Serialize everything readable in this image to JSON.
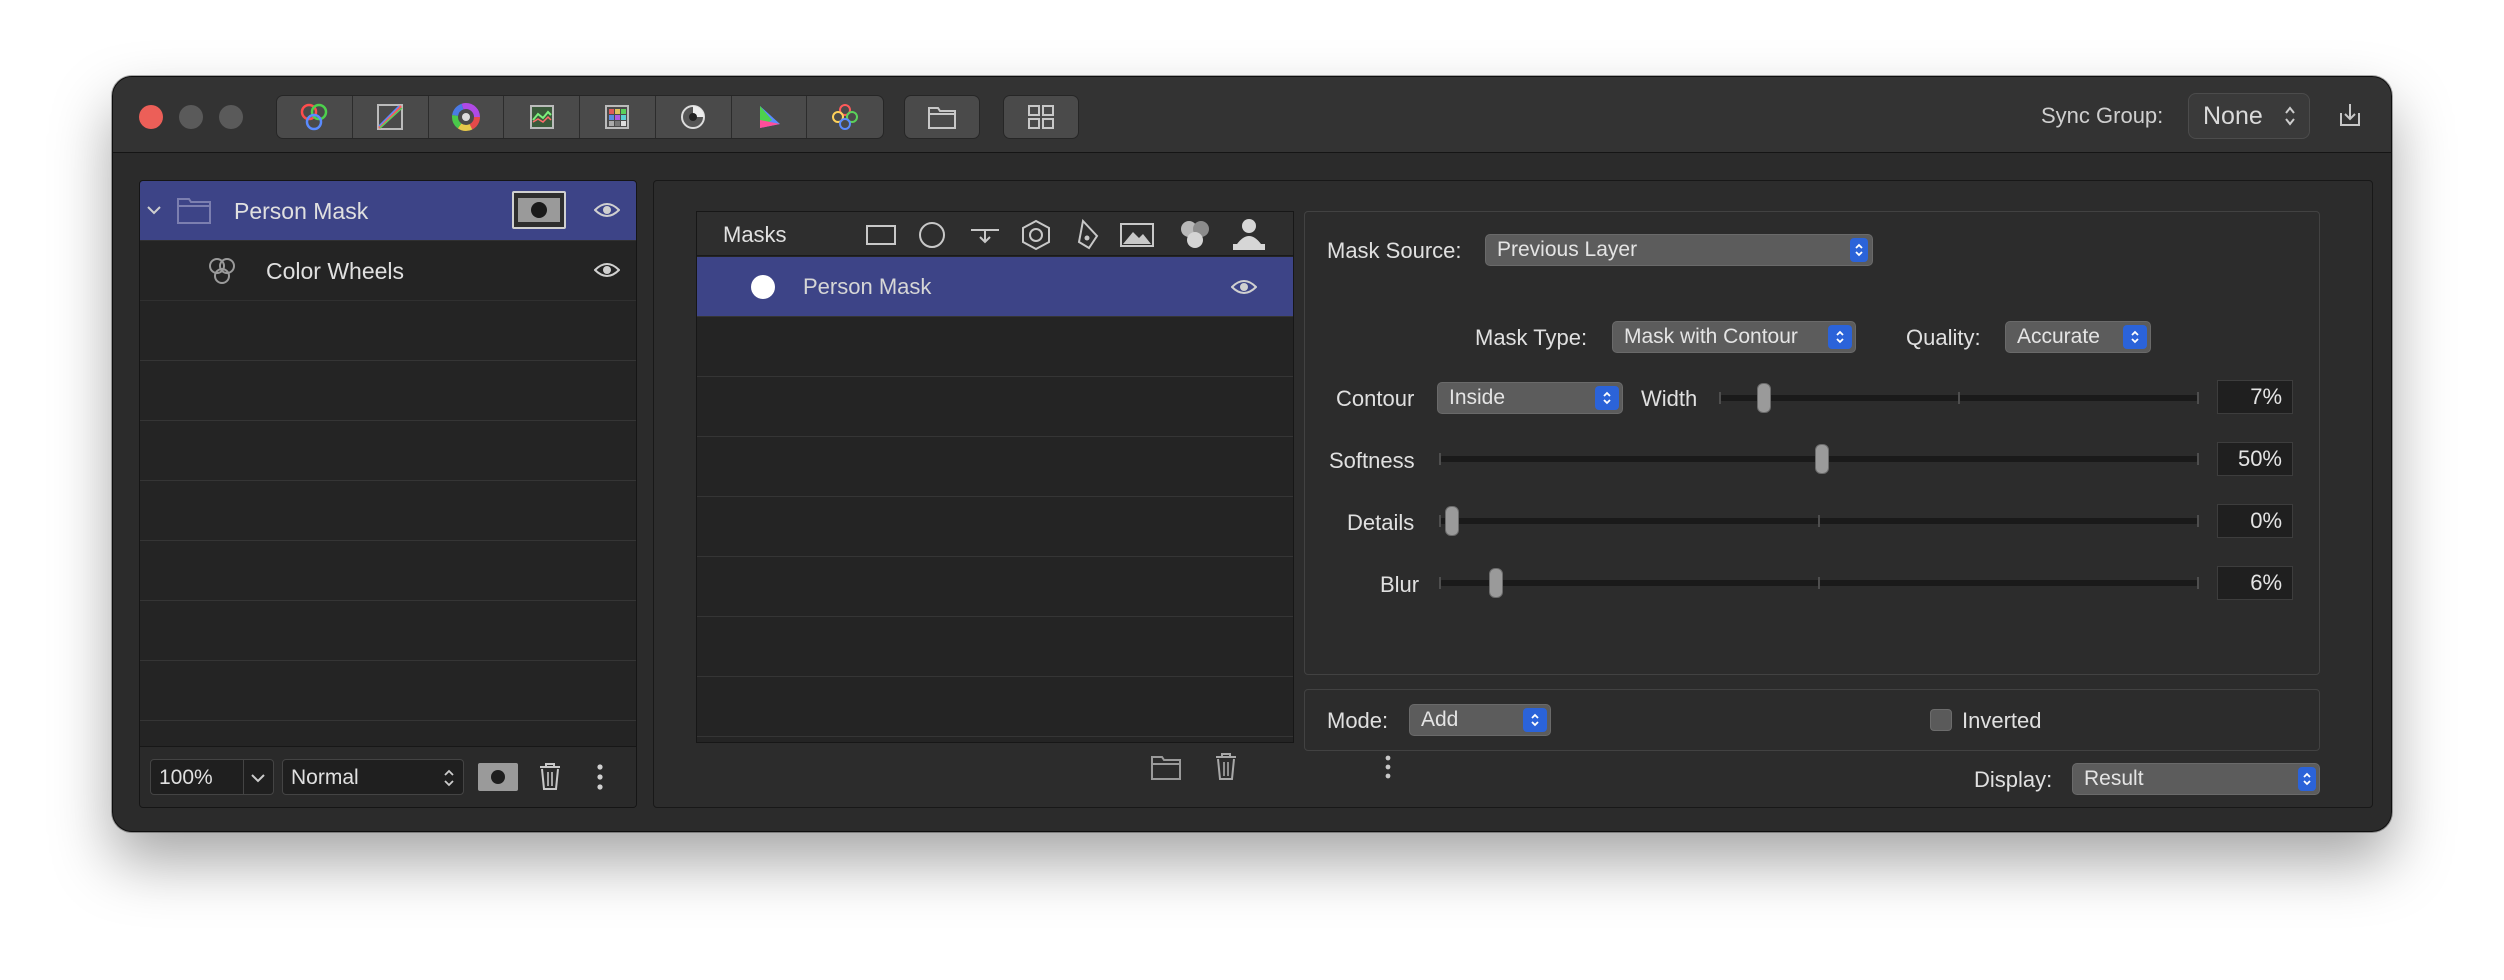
{
  "toolbar": {
    "sync_label": "Sync Group:",
    "sync_value": "None",
    "buttons": [
      "color-wheels-icon",
      "curves-icon",
      "hue-ring-icon",
      "waveform-icon",
      "grid-lut-icon",
      "lens-icon",
      "gamut-triangle-icon",
      "color-channels-icon",
      "folder-icon",
      "grid-view-icon",
      "export-icon"
    ]
  },
  "layers": {
    "items": [
      {
        "label": "Person Mask",
        "selected": true
      },
      {
        "label": "Color Wheels",
        "selected": false
      }
    ],
    "footer": {
      "zoom": "100%",
      "blend_mode": "Normal"
    }
  },
  "masks": {
    "header": "Masks",
    "items": [
      {
        "label": "Person Mask",
        "selected": true
      }
    ]
  },
  "settings": {
    "mask_source_label": "Mask Source:",
    "mask_source_value": "Previous Layer",
    "mask_type_label": "Mask Type:",
    "mask_type_value": "Mask with Contour",
    "quality_label": "Quality:",
    "quality_value": "Accurate",
    "contour_label": "Contour",
    "contour_value": "Inside",
    "width_label": "Width",
    "width_value": "7%",
    "width_fraction": 0.07,
    "softness_label": "Softness",
    "softness_value": "50%",
    "softness_fraction": 0.5,
    "details_label": "Details",
    "details_value": "0%",
    "details_fraction": 0.0,
    "blur_label": "Blur",
    "blur_value": "6%",
    "blur_fraction": 0.06
  },
  "mode": {
    "label": "Mode:",
    "value": "Add",
    "inverted_label": "Inverted",
    "inverted_checked": false
  },
  "display": {
    "label": "Display:",
    "value": "Result"
  },
  "colors": {
    "selection": "#3d4487",
    "accent": "#2b63d9",
    "close": "#ec5f58"
  }
}
